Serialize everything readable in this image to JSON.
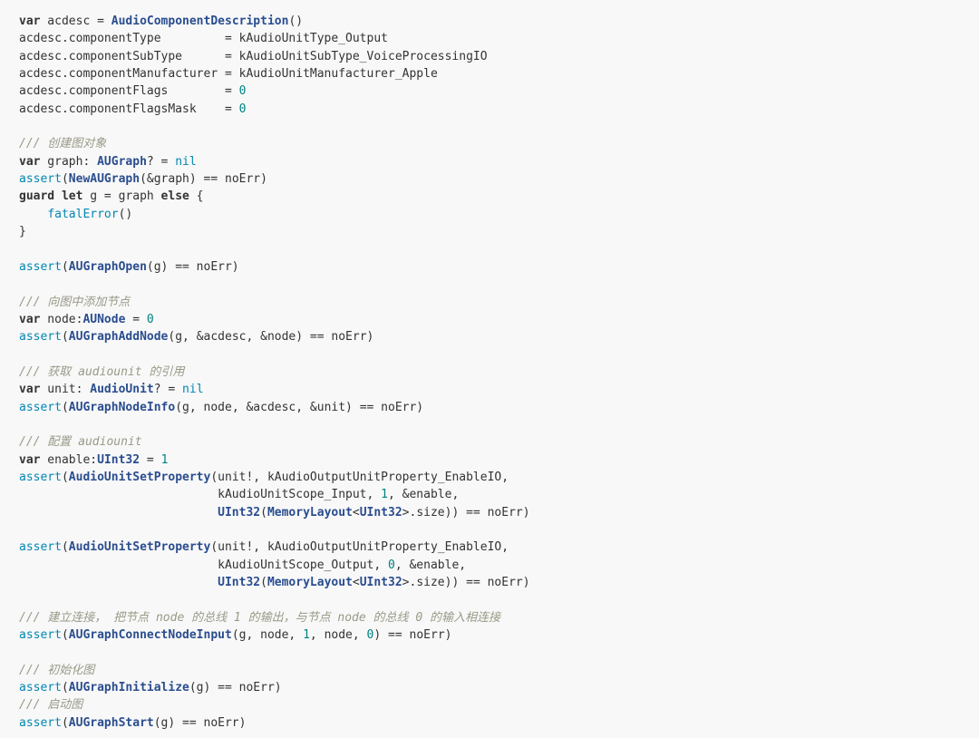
{
  "code": {
    "language": "swift",
    "lines": [
      [
        {
          "t": "kw",
          "v": "var"
        },
        {
          "t": "tx",
          "v": " acdesc = "
        },
        {
          "t": "fn",
          "v": "AudioComponentDescription"
        },
        {
          "t": "tx",
          "v": "()"
        }
      ],
      [
        {
          "t": "tx",
          "v": "acdesc.componentType         = kAudioUnitType_Output"
        }
      ],
      [
        {
          "t": "tx",
          "v": "acdesc.componentSubType      = kAudioUnitSubType_VoiceProcessingIO"
        }
      ],
      [
        {
          "t": "tx",
          "v": "acdesc.componentManufacturer = kAudioUnitManufacturer_Apple"
        }
      ],
      [
        {
          "t": "tx",
          "v": "acdesc.componentFlags        = "
        },
        {
          "t": "num",
          "v": "0"
        }
      ],
      [
        {
          "t": "tx",
          "v": "acdesc.componentFlagsMask    = "
        },
        {
          "t": "num",
          "v": "0"
        }
      ],
      [],
      [
        {
          "t": "cm",
          "v": "/// 创建图对象"
        }
      ],
      [
        {
          "t": "kw",
          "v": "var"
        },
        {
          "t": "tx",
          "v": " graph: "
        },
        {
          "t": "ty",
          "v": "AUGraph"
        },
        {
          "t": "tx",
          "v": "? = "
        },
        {
          "t": "bi",
          "v": "nil"
        }
      ],
      [
        {
          "t": "bi",
          "v": "assert"
        },
        {
          "t": "tx",
          "v": "("
        },
        {
          "t": "fn",
          "v": "NewAUGraph"
        },
        {
          "t": "tx",
          "v": "(&graph) == noErr)"
        }
      ],
      [
        {
          "t": "kw",
          "v": "guard"
        },
        {
          "t": "tx",
          "v": " "
        },
        {
          "t": "kw",
          "v": "let"
        },
        {
          "t": "tx",
          "v": " g = graph "
        },
        {
          "t": "kw",
          "v": "else"
        },
        {
          "t": "tx",
          "v": " {"
        }
      ],
      [
        {
          "t": "tx",
          "v": "    "
        },
        {
          "t": "bi",
          "v": "fatalError"
        },
        {
          "t": "tx",
          "v": "()"
        }
      ],
      [
        {
          "t": "tx",
          "v": "}"
        }
      ],
      [],
      [
        {
          "t": "bi",
          "v": "assert"
        },
        {
          "t": "tx",
          "v": "("
        },
        {
          "t": "fn",
          "v": "AUGraphOpen"
        },
        {
          "t": "tx",
          "v": "(g) == noErr)"
        }
      ],
      [],
      [
        {
          "t": "cm",
          "v": "/// 向图中添加节点"
        }
      ],
      [
        {
          "t": "kw",
          "v": "var"
        },
        {
          "t": "tx",
          "v": " node:"
        },
        {
          "t": "ty",
          "v": "AUNode"
        },
        {
          "t": "tx",
          "v": " = "
        },
        {
          "t": "num",
          "v": "0"
        }
      ],
      [
        {
          "t": "bi",
          "v": "assert"
        },
        {
          "t": "tx",
          "v": "("
        },
        {
          "t": "fn",
          "v": "AUGraphAddNode"
        },
        {
          "t": "tx",
          "v": "(g, &acdesc, &node) == noErr)"
        }
      ],
      [],
      [
        {
          "t": "cm",
          "v": "/// 获取 audiounit 的引用"
        }
      ],
      [
        {
          "t": "kw",
          "v": "var"
        },
        {
          "t": "tx",
          "v": " unit: "
        },
        {
          "t": "ty",
          "v": "AudioUnit"
        },
        {
          "t": "tx",
          "v": "? = "
        },
        {
          "t": "bi",
          "v": "nil"
        }
      ],
      [
        {
          "t": "bi",
          "v": "assert"
        },
        {
          "t": "tx",
          "v": "("
        },
        {
          "t": "fn",
          "v": "AUGraphNodeInfo"
        },
        {
          "t": "tx",
          "v": "(g, node, &acdesc, &unit) == noErr)"
        }
      ],
      [],
      [
        {
          "t": "cm",
          "v": "/// 配置 audiounit"
        }
      ],
      [
        {
          "t": "kw",
          "v": "var"
        },
        {
          "t": "tx",
          "v": " enable:"
        },
        {
          "t": "ty",
          "v": "UInt32"
        },
        {
          "t": "tx",
          "v": " = "
        },
        {
          "t": "num",
          "v": "1"
        }
      ],
      [
        {
          "t": "bi",
          "v": "assert"
        },
        {
          "t": "tx",
          "v": "("
        },
        {
          "t": "fn",
          "v": "AudioUnitSetProperty"
        },
        {
          "t": "tx",
          "v": "(unit!, kAudioOutputUnitProperty_EnableIO,"
        }
      ],
      [
        {
          "t": "tx",
          "v": "                            kAudioUnitScope_Input, "
        },
        {
          "t": "num",
          "v": "1"
        },
        {
          "t": "tx",
          "v": ", &enable,"
        }
      ],
      [
        {
          "t": "tx",
          "v": "                            "
        },
        {
          "t": "ty",
          "v": "UInt32"
        },
        {
          "t": "tx",
          "v": "("
        },
        {
          "t": "ty",
          "v": "MemoryLayout"
        },
        {
          "t": "tx",
          "v": "<"
        },
        {
          "t": "ty",
          "v": "UInt32"
        },
        {
          "t": "tx",
          "v": ">.size)) == noErr)"
        }
      ],
      [],
      [
        {
          "t": "bi",
          "v": "assert"
        },
        {
          "t": "tx",
          "v": "("
        },
        {
          "t": "fn",
          "v": "AudioUnitSetProperty"
        },
        {
          "t": "tx",
          "v": "(unit!, kAudioOutputUnitProperty_EnableIO,"
        }
      ],
      [
        {
          "t": "tx",
          "v": "                            kAudioUnitScope_Output, "
        },
        {
          "t": "num",
          "v": "0"
        },
        {
          "t": "tx",
          "v": ", &enable,"
        }
      ],
      [
        {
          "t": "tx",
          "v": "                            "
        },
        {
          "t": "ty",
          "v": "UInt32"
        },
        {
          "t": "tx",
          "v": "("
        },
        {
          "t": "ty",
          "v": "MemoryLayout"
        },
        {
          "t": "tx",
          "v": "<"
        },
        {
          "t": "ty",
          "v": "UInt32"
        },
        {
          "t": "tx",
          "v": ">.size)) == noErr)"
        }
      ],
      [],
      [
        {
          "t": "cm",
          "v": "/// 建立连接， 把节点 node 的总线 1 的输出，与节点 node 的总线 0 的输入相连接"
        }
      ],
      [
        {
          "t": "bi",
          "v": "assert"
        },
        {
          "t": "tx",
          "v": "("
        },
        {
          "t": "fn",
          "v": "AUGraphConnectNodeInput"
        },
        {
          "t": "tx",
          "v": "(g, node, "
        },
        {
          "t": "num",
          "v": "1"
        },
        {
          "t": "tx",
          "v": ", node, "
        },
        {
          "t": "num",
          "v": "0"
        },
        {
          "t": "tx",
          "v": ") == noErr)"
        }
      ],
      [],
      [
        {
          "t": "cm",
          "v": "/// 初始化图"
        }
      ],
      [
        {
          "t": "bi",
          "v": "assert"
        },
        {
          "t": "tx",
          "v": "("
        },
        {
          "t": "fn",
          "v": "AUGraphInitialize"
        },
        {
          "t": "tx",
          "v": "(g) == noErr)"
        }
      ],
      [
        {
          "t": "cm",
          "v": "/// 启动图"
        }
      ],
      [
        {
          "t": "bi",
          "v": "assert"
        },
        {
          "t": "tx",
          "v": "("
        },
        {
          "t": "fn",
          "v": "AUGraphStart"
        },
        {
          "t": "tx",
          "v": "(g) == noErr)"
        }
      ]
    ]
  }
}
